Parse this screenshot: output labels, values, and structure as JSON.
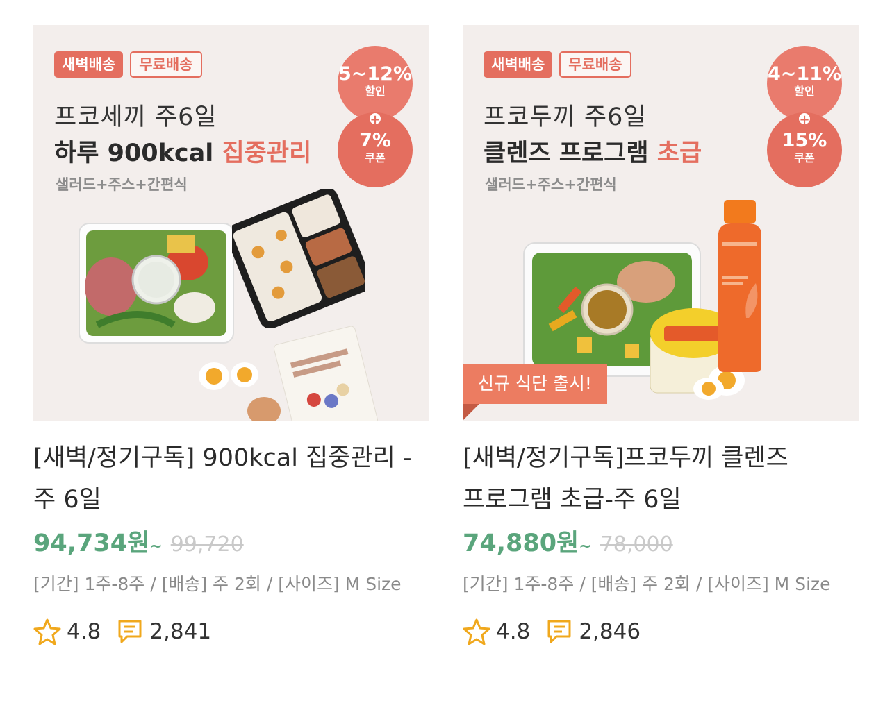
{
  "products": [
    {
      "tags": [
        "새벽배송",
        "무료배송"
      ],
      "headline_line1": "프코세끼 주6일",
      "headline_line2_plain": "하루 900kcal ",
      "headline_line2_highlight": "집중관리",
      "headline_line3": "샐러드+주스+간편식",
      "badge_top": {
        "value": "5~12%",
        "label": "할인"
      },
      "badge_bottom": {
        "value": "7%",
        "label": "쿠폰"
      },
      "ribbon": "",
      "title": "[새벽/정기구독] 900kcal 집중관리 - 주 6일",
      "price": "94,734원",
      "price_suffix": "~",
      "original_price": "99,720",
      "options": "[기간] 1주-8주 / [배송] 주 2회 / [사이즈] M Size",
      "rating": "4.8",
      "reviews": "2,841"
    },
    {
      "tags": [
        "새벽배송",
        "무료배송"
      ],
      "headline_line1": "프코두끼 주6일",
      "headline_line2_plain": "클렌즈 프로그램 ",
      "headline_line2_highlight": "초급",
      "headline_line3": "샐러드+주스+간편식",
      "badge_top": {
        "value": "4~11%",
        "label": "할인"
      },
      "badge_bottom": {
        "value": "15%",
        "label": "쿠폰"
      },
      "ribbon": "신규 식단 출시!",
      "title": "[새벽/정기구독]프코두끼 클렌즈 프로그램 초급-주 6일",
      "price": "74,880원",
      "price_suffix": "~",
      "original_price": "78,000",
      "options": "[기간] 1주-8주 / [배송] 주 2회 / [사이즈] M Size",
      "rating": "4.8",
      "reviews": "2,846"
    }
  ],
  "badge_plus": "+",
  "colors": {
    "accent": "#e46e5f",
    "price": "#5aa57c",
    "ribbon": "#ec7c61",
    "thumb_bg": "#f3eeec"
  },
  "icons": [
    "star-icon",
    "review-bubble-icon"
  ]
}
